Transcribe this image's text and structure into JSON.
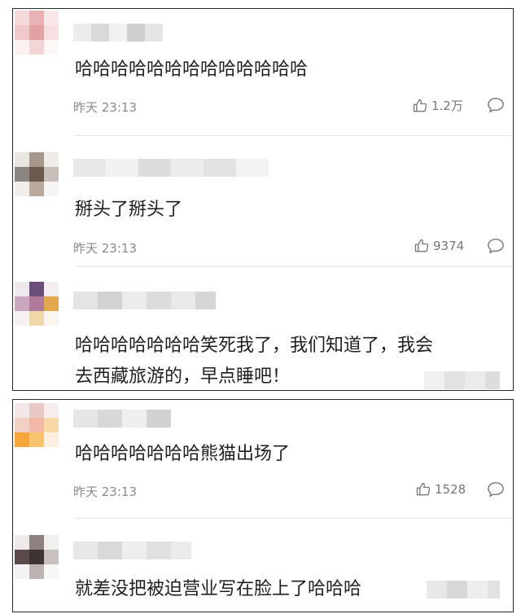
{
  "panel1": {
    "comments": [
      {
        "text": "哈哈哈哈哈哈哈哈哈哈哈哈哈",
        "time": "昨天 23:13",
        "likes": "1.2万"
      },
      {
        "text": "掰头了掰头了",
        "time": "昨天 23:13",
        "likes": "9374"
      },
      {
        "text_line1": "哈哈哈哈哈哈哈笑死我了，我们知道了，我会",
        "text_line2": "去西藏旅游的，早点睡吧！"
      }
    ]
  },
  "panel2": {
    "comments": [
      {
        "text": "哈哈哈哈哈哈哈熊猫出场了",
        "time": "昨天 23:13",
        "likes": "1528"
      },
      {
        "text": "就差没把被迫营业写在脸上了哈哈哈"
      }
    ]
  },
  "icons": {
    "like": "thumbs-up-icon",
    "reply": "comment-bubble-icon"
  },
  "colors": {
    "text": "#1f1f1f",
    "meta": "#8a8a8a",
    "border": "#2a2a2a",
    "divider": "#e5e5e5"
  }
}
